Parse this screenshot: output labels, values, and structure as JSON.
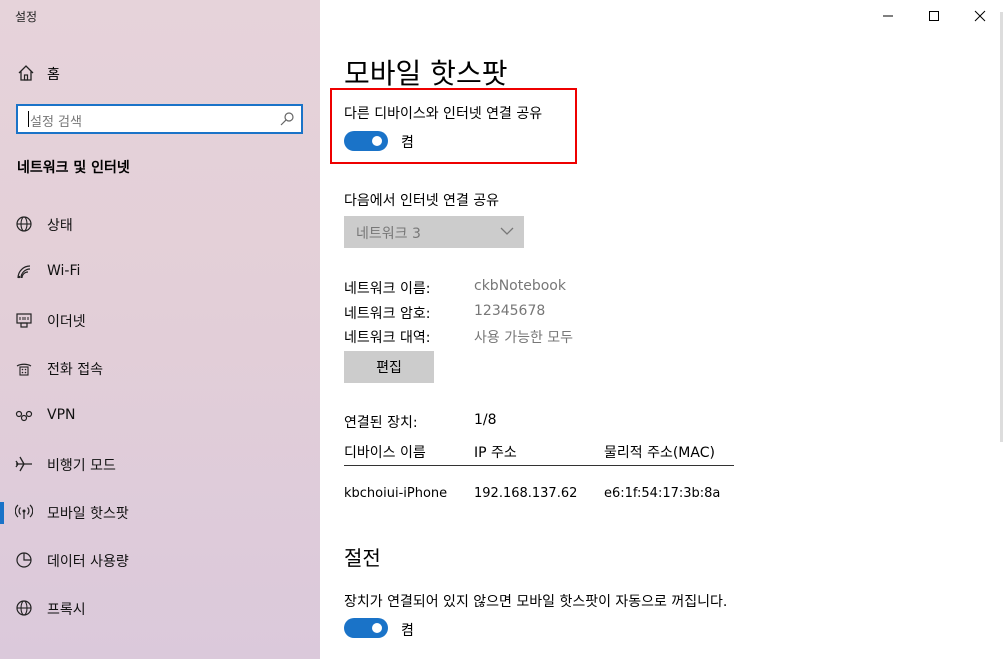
{
  "app": {
    "title": "설정"
  },
  "sidebar": {
    "home_label": "홈",
    "search_placeholder": "설정 검색",
    "section_title": "네트워크 및 인터넷",
    "items": [
      {
        "label": "상태",
        "icon": "globe-status-icon"
      },
      {
        "label": "Wi-Fi",
        "icon": "wifi-icon"
      },
      {
        "label": "이더넷",
        "icon": "ethernet-icon"
      },
      {
        "label": "전화 접속",
        "icon": "dialup-icon"
      },
      {
        "label": "VPN",
        "icon": "vpn-icon"
      },
      {
        "label": "비행기 모드",
        "icon": "airplane-icon"
      },
      {
        "label": "모바일 핫스팟",
        "icon": "hotspot-icon",
        "active": true
      },
      {
        "label": "데이터 사용량",
        "icon": "data-usage-icon"
      },
      {
        "label": "프록시",
        "icon": "proxy-globe-icon"
      }
    ]
  },
  "main": {
    "title": "모바일 핫스팟",
    "share": {
      "label": "다른 디바이스와 인터넷 연결 공유",
      "toggle_state": "켬"
    },
    "share_from": {
      "label": "다음에서 인터넷 연결 공유",
      "selected": "네트워크 3"
    },
    "network": {
      "name_label": "네트워크 이름:",
      "name_value": "ckbNotebook",
      "password_label": "네트워크 암호:",
      "password_value": "12345678",
      "band_label": "네트워크 대역:",
      "band_value": "사용 가능한 모두"
    },
    "edit_button": "편집",
    "connected": {
      "label": "연결된 장치:",
      "value": "1/8",
      "columns": [
        "디바이스 이름",
        "IP 주소",
        "물리적 주소(MAC)"
      ],
      "rows": [
        [
          "kbchoiui-iPhone",
          "192.168.137.62",
          "e6:1f:54:17:3b:8a"
        ]
      ]
    },
    "power_save": {
      "title": "절전",
      "description": "장치가 연결되어 있지 않으면 모바일 핫스팟이 자동으로 꺼집니다.",
      "toggle_state": "켬"
    }
  },
  "colors": {
    "accent": "#1a73c8",
    "highlight": "#e00000"
  }
}
